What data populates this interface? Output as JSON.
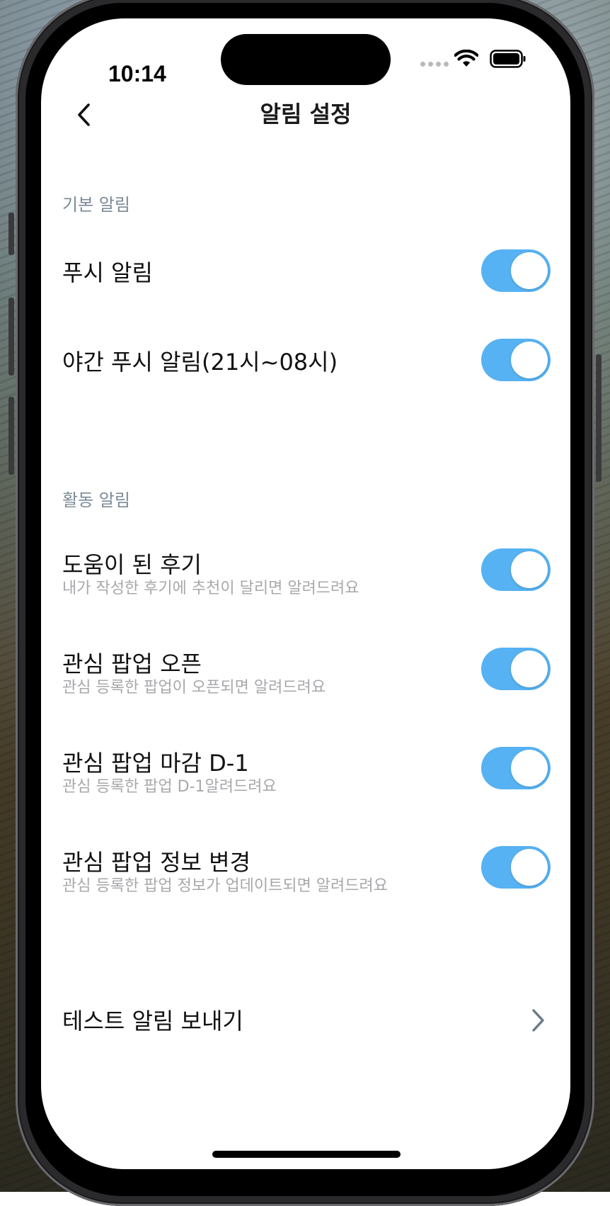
{
  "status_bar": {
    "time": "10:14",
    "wifi_icon": "wifi-icon",
    "battery_icon": "battery-icon"
  },
  "nav": {
    "title": "알림 설정",
    "back_icon": "chevron-left-icon"
  },
  "sections": {
    "basic": {
      "header": "기본 알림",
      "items": [
        {
          "title": "푸시 알림",
          "enabled": true
        },
        {
          "title": "야간 푸시 알림(21시~08시)",
          "enabled": true
        }
      ]
    },
    "activity": {
      "header": "활동 알림",
      "items": [
        {
          "title": "도움이 된 후기",
          "subtitle": "내가 작성한 후기에 추천이 달리면 알려드려요",
          "enabled": true
        },
        {
          "title": "관심 팝업 오픈",
          "subtitle": "관심 등록한 팝업이 오픈되면 알려드려요",
          "enabled": true
        },
        {
          "title": "관심 팝업 마감 D-1",
          "subtitle": "관심 등록한 팝업 D-1알려드려요",
          "enabled": true
        },
        {
          "title": "관심 팝업 정보 변경",
          "subtitle": "관심 등록한 팝업 정보가 업데이트되면 알려드려요",
          "enabled": true
        }
      ]
    }
  },
  "test_notification": {
    "label": "테스트 알림 보내기",
    "chevron_icon": "chevron-right-icon"
  },
  "colors": {
    "toggle_on": "#56b2f2",
    "section_header": "#7b8a96",
    "subtitle": "#a8a8ac"
  }
}
